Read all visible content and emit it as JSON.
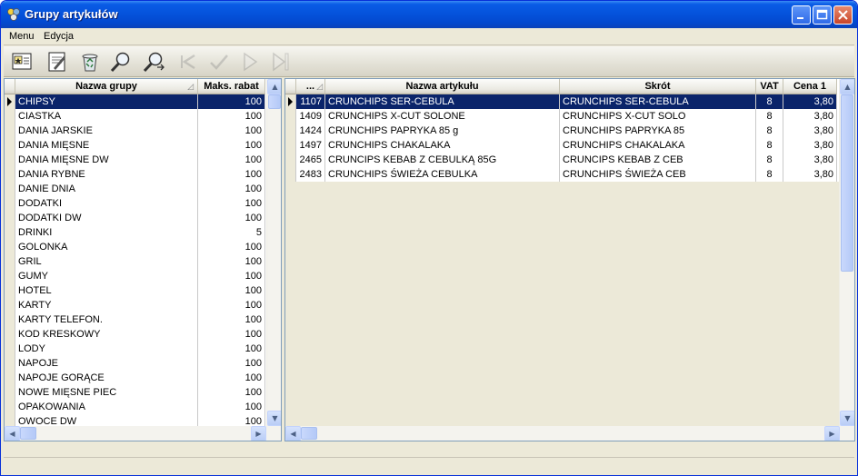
{
  "window": {
    "title": "Grupy artykułów"
  },
  "menu": [
    {
      "label": "Menu"
    },
    {
      "label": "Edycja"
    }
  ],
  "toolbar": [
    {
      "icon": "card-icon"
    },
    {
      "icon": "edit-icon"
    },
    {
      "icon": "recycle-icon"
    },
    {
      "icon": "search-icon"
    },
    {
      "icon": "search-next-icon"
    },
    {
      "icon": "back-icon",
      "disabled": true
    },
    {
      "icon": "check-icon",
      "disabled": true
    },
    {
      "icon": "play-icon",
      "disabled": true
    },
    {
      "icon": "skip-end-icon",
      "disabled": true
    }
  ],
  "groups": {
    "columns": [
      "Nazwa grupy",
      "Maks. rabat"
    ],
    "rows": [
      [
        "CHIPSY",
        "100"
      ],
      [
        "CIASTKA",
        "100"
      ],
      [
        "DANIA JARSKIE",
        "100"
      ],
      [
        "DANIA MIĘSNE",
        "100"
      ],
      [
        "DANIA MIĘSNE DW",
        "100"
      ],
      [
        "DANIA RYBNE",
        "100"
      ],
      [
        "DANIE DNIA",
        "100"
      ],
      [
        "DODATKI",
        "100"
      ],
      [
        "DODATKI DW",
        "100"
      ],
      [
        "DRINKI",
        "5"
      ],
      [
        "GOLONKA",
        "100"
      ],
      [
        "GRIL",
        "100"
      ],
      [
        "GUMY",
        "100"
      ],
      [
        "HOTEL",
        "100"
      ],
      [
        "KARTY",
        "100"
      ],
      [
        "KARTY TELEFON.",
        "100"
      ],
      [
        "KOD KRESKOWY",
        "100"
      ],
      [
        "LODY",
        "100"
      ],
      [
        "NAPOJE",
        "100"
      ],
      [
        "NAPOJE GORĄCE",
        "100"
      ],
      [
        "NOWE MIĘSNE PIEC",
        "100"
      ],
      [
        "OPAKOWANIA",
        "100"
      ],
      [
        "OWOCE DW",
        "100"
      ]
    ]
  },
  "articles": {
    "columns": [
      "...",
      "Nazwa artykułu",
      "Skrót",
      "VAT",
      "Cena 1"
    ],
    "rows": [
      [
        "1107",
        "CRUNCHIPS SER-CEBULA",
        "CRUNCHIPS SER-CEBULA",
        "8",
        "3,80"
      ],
      [
        "1409",
        "CRUNCHIPS X-CUT SOLONE",
        "CRUNCHIPS X-CUT SOLO",
        "8",
        "3,80"
      ],
      [
        "1424",
        "CRUNCHIPS PAPRYKA 85 g",
        "CRUNCHIPS PAPRYKA 85",
        "8",
        "3,80"
      ],
      [
        "1497",
        "CRUNCHIPS CHAKALAKA",
        "CRUNCHIPS CHAKALAKA",
        "8",
        "3,80"
      ],
      [
        "2465",
        "CRUNCIPS KEBAB Z CEBULKĄ 85G",
        "CRUNCIPS KEBAB Z CEB",
        "8",
        "3,80"
      ],
      [
        "2483",
        "CRUNCHIPS ŚWIEŻA CEBULKA",
        "CRUNCHIPS ŚWIEŻA CEB",
        "8",
        "3,80"
      ]
    ]
  }
}
